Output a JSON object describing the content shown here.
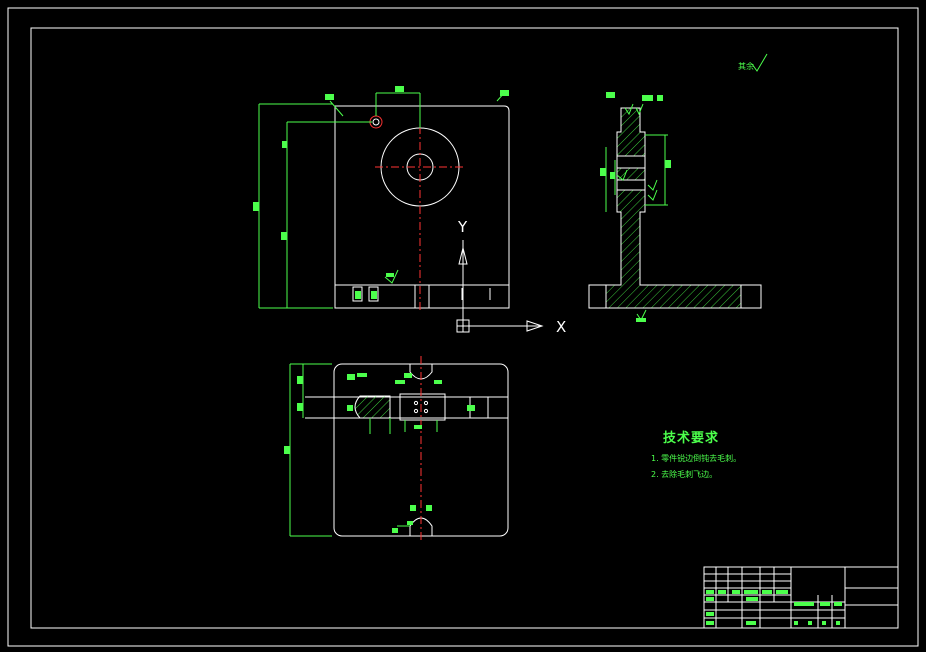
{
  "technical_requirements": {
    "title": "技术要求",
    "items": [
      "1. 零件锐边倒钝去毛刺。",
      "2. 去除毛刺飞边。"
    ]
  },
  "ucs": {
    "y_label": "Y",
    "x_label": "X"
  },
  "roughness_note": "其余",
  "colors": {
    "background": "#000000",
    "outline": "#ffffff",
    "dimension": "#4cff4c",
    "centerline": "#ff3333",
    "hatch": "#4cff4c"
  }
}
